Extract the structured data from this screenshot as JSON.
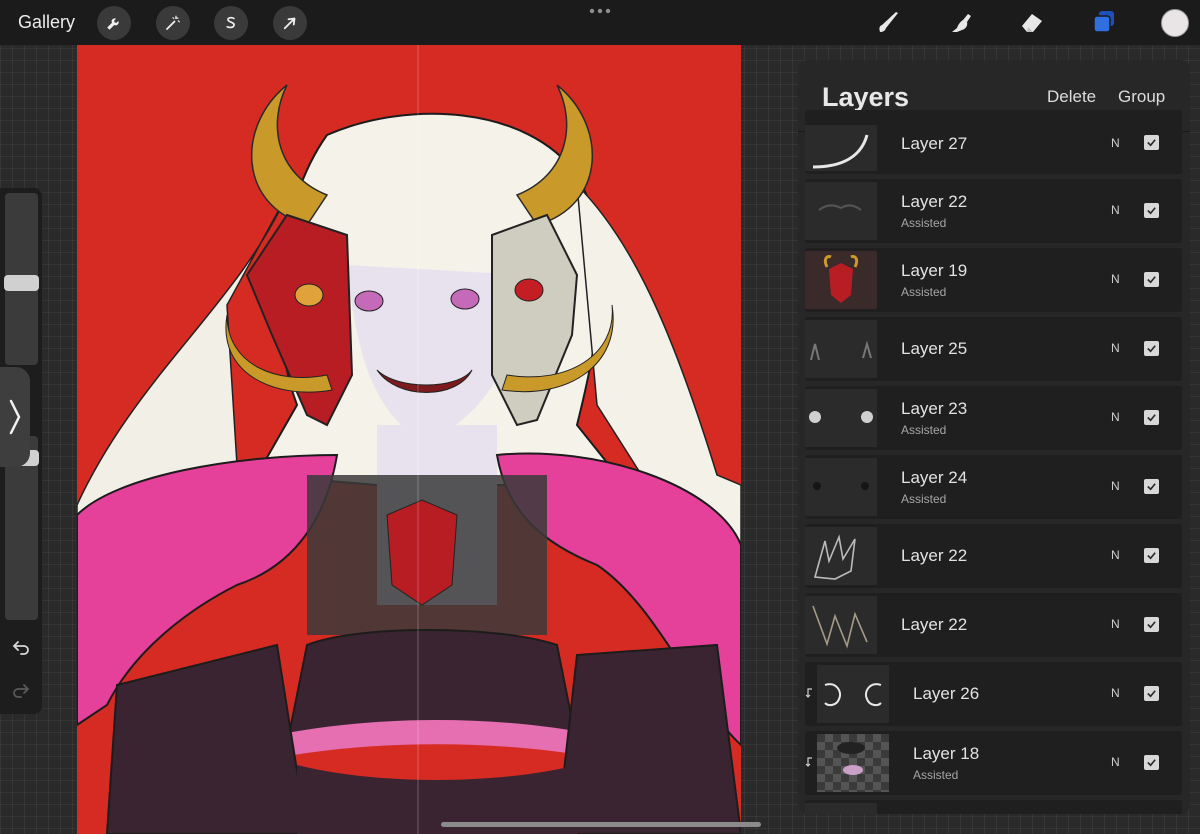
{
  "topbar": {
    "gallery_label": "Gallery",
    "left_tools": [
      {
        "name": "actions",
        "icon": "wrench-icon"
      },
      {
        "name": "adjustments",
        "icon": "magic-wand-icon"
      },
      {
        "name": "selection",
        "icon": "selection-s-icon"
      },
      {
        "name": "transform",
        "icon": "arrow-cursor-icon"
      }
    ],
    "right_tools": [
      {
        "name": "brush",
        "icon": "brush-icon"
      },
      {
        "name": "smudge",
        "icon": "smudge-finger-icon"
      },
      {
        "name": "eraser",
        "icon": "eraser-icon"
      },
      {
        "name": "layers",
        "icon": "layers-icon",
        "active": true
      }
    ],
    "accent_color": "#2f6fe0",
    "current_color": "#e9e4e6"
  },
  "layers": {
    "title": "Layers",
    "delete_label": "Delete",
    "group_label": "Group",
    "items": [
      {
        "name": "Layer 27",
        "sub": "",
        "mode": "N",
        "visible": true,
        "clipped": false
      },
      {
        "name": "Layer 22",
        "sub": "Assisted",
        "mode": "N",
        "visible": true,
        "clipped": false
      },
      {
        "name": "Layer 19",
        "sub": "Assisted",
        "mode": "N",
        "visible": true,
        "clipped": false
      },
      {
        "name": "Layer 25",
        "sub": "",
        "mode": "N",
        "visible": true,
        "clipped": false
      },
      {
        "name": "Layer 23",
        "sub": "Assisted",
        "mode": "N",
        "visible": true,
        "clipped": false
      },
      {
        "name": "Layer 24",
        "sub": "Assisted",
        "mode": "N",
        "visible": true,
        "clipped": false
      },
      {
        "name": "Layer 22",
        "sub": "",
        "mode": "N",
        "visible": true,
        "clipped": false
      },
      {
        "name": "Layer 22",
        "sub": "",
        "mode": "N",
        "visible": true,
        "clipped": false
      },
      {
        "name": "Layer 26",
        "sub": "",
        "mode": "N",
        "visible": true,
        "clipped": true
      },
      {
        "name": "Layer 18",
        "sub": "Assisted",
        "mode": "N",
        "visible": true,
        "clipped": true
      }
    ]
  },
  "canvas": {
    "background_color": "#d52b23"
  }
}
